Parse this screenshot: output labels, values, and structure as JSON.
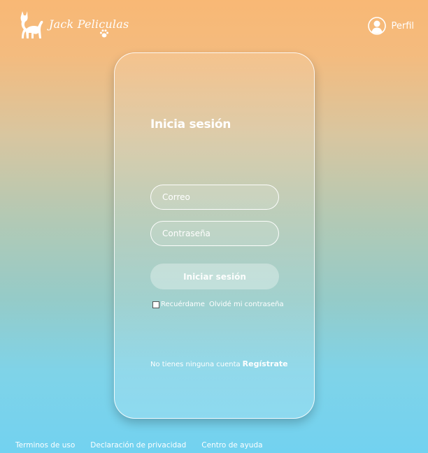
{
  "header": {
    "brand_name": "Jack Peliculas",
    "logo_icon": "cat-icon",
    "paw_icon": "paw-icon",
    "profile_label": "Perfil",
    "profile_icon": "user-avatar-icon"
  },
  "login": {
    "title": "Inicia sesión",
    "email_placeholder": "Correo",
    "password_placeholder": "Contraseña",
    "submit_label": "Iniciar sesión",
    "remember_label": "Recuérdame",
    "forgot_label": "Olvidé mi contraseña",
    "signup_prompt": "No tienes ninguna cuenta",
    "signup_link": "Regístrate"
  },
  "footer": {
    "terms": "Terminos de uso",
    "privacy": "Declaración de privacidad",
    "help": "Centro de ayuda"
  },
  "colors": {
    "gradient_top": "#f8b875",
    "gradient_bottom": "#72d2f0",
    "text": "#ffffff"
  }
}
